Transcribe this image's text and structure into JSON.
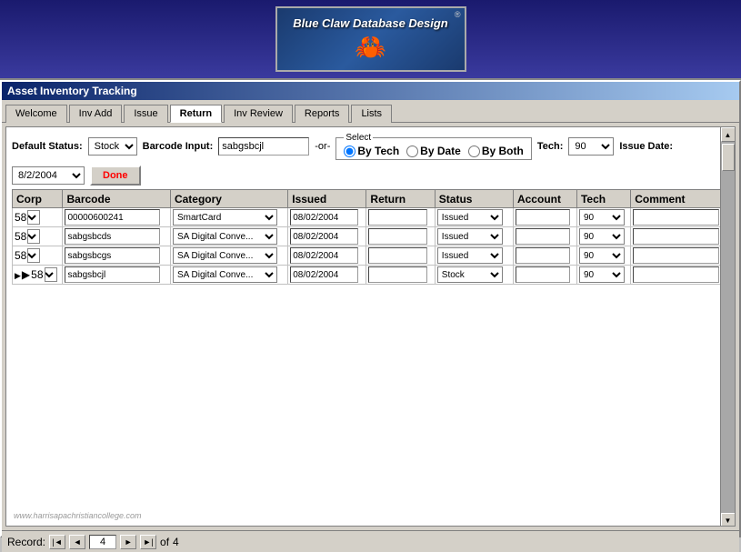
{
  "header": {
    "logo_title": "Blue Claw Database Design",
    "logo_reg": "®"
  },
  "titlebar": {
    "text": "Asset Inventory Tracking"
  },
  "tabs": [
    {
      "label": "Welcome",
      "active": false
    },
    {
      "label": "Inv Add",
      "active": false
    },
    {
      "label": "Issue",
      "active": false
    },
    {
      "label": "Return",
      "active": true
    },
    {
      "label": "Inv Review",
      "active": false
    },
    {
      "label": "Reports",
      "active": false
    },
    {
      "label": "Lists",
      "active": false
    }
  ],
  "toolbar": {
    "default_status_label": "Default Status:",
    "default_status_value": "Stock",
    "barcode_label": "Barcode Input:",
    "barcode_value": "sabgsbcjl",
    "or_text": "-or-",
    "select_group_label": "Select",
    "radio_options": [
      "By Tech",
      "By Date",
      "By Both"
    ],
    "radio_selected": "By Tech",
    "tech_label": "Tech:",
    "tech_value": "90",
    "issue_date_label": "Issue Date:",
    "issue_date_value": "8/2/2004",
    "done_label": "Done"
  },
  "table": {
    "headers": [
      "Corp",
      "Barcode",
      "Category",
      "Issued",
      "Return",
      "Status",
      "Account",
      "Tech",
      "Comment"
    ],
    "rows": [
      {
        "corp": "58",
        "barcode": "00000600241",
        "category": "SmartCard",
        "issued": "08/02/2004",
        "return": "",
        "status": "Issued",
        "account": "",
        "tech": "90",
        "comment": "",
        "current": false
      },
      {
        "corp": "58",
        "barcode": "sabgsbcds",
        "category": "SA Digital Conve...",
        "issued": "08/02/2004",
        "return": "",
        "status": "Issued",
        "account": "",
        "tech": "90",
        "comment": "",
        "current": false
      },
      {
        "corp": "58",
        "barcode": "sabgsbcgs",
        "category": "SA Digital Conve...",
        "issued": "08/02/2004",
        "return": "",
        "status": "Issued",
        "account": "",
        "tech": "90",
        "comment": "",
        "current": false
      },
      {
        "corp": "58",
        "barcode": "sabgsbcjl",
        "category": "SA Digital Conve...",
        "issued": "08/02/2004",
        "return": "",
        "status": "Stock",
        "account": "",
        "tech": "90",
        "comment": "",
        "current": true
      }
    ]
  },
  "statusbar": {
    "record_label": "Record:",
    "current_record": "4",
    "total_records": "4",
    "of_label": "of"
  },
  "watermark": "www.harrisapachristiancollege.com"
}
